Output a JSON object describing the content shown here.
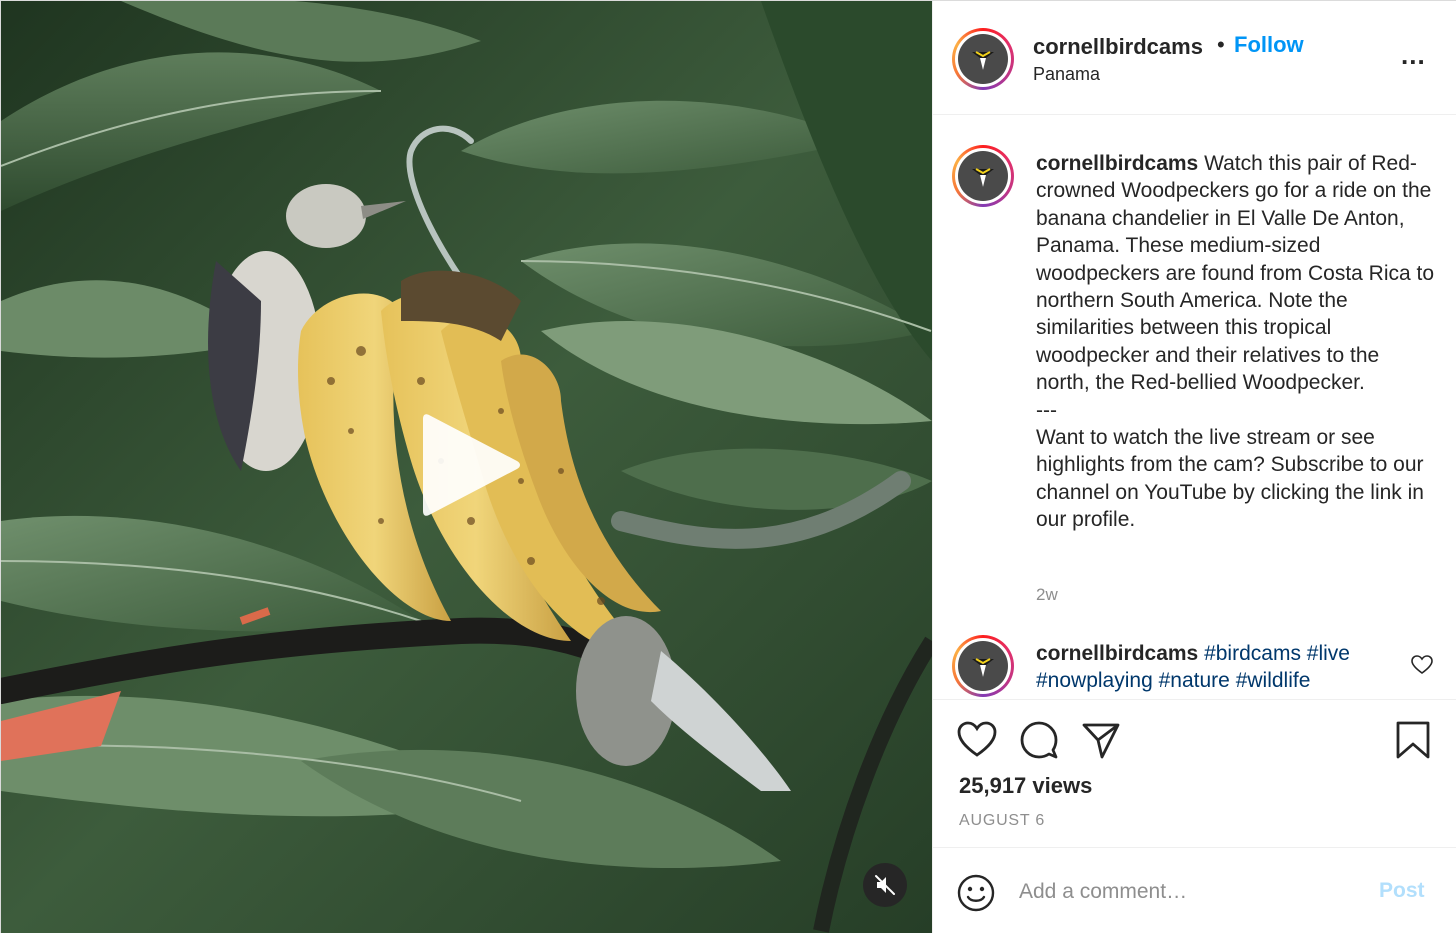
{
  "post": {
    "username": "cornellbirdcams",
    "separator": "•",
    "follow_label": "Follow",
    "location": "Panama",
    "more_label": "..."
  },
  "caption": {
    "username": "cornellbirdcams",
    "text": "Watch this pair of Red-crowned Woodpeckers go for a ride on the banana chandelier in El Valle De Anton, Panama. These medium-sized woodpeckers are found from Costa Rica to northern South America. Note the similarities between this tropical woodpecker and their relatives to the north, the Red-bellied Woodpecker.",
    "divider": "---",
    "text2": "Want to watch the live stream or see highlights from the cam? Subscribe to our channel on YouTube by clicking the link in our profile.",
    "time": "2w"
  },
  "second_comment": {
    "username": "cornellbirdcams",
    "tags": [
      "#birdcams",
      "#live",
      "#nowplaying",
      "#nature",
      "#wildlife"
    ]
  },
  "stats": {
    "views": "25,917 views",
    "date": "AUGUST 6"
  },
  "composer": {
    "placeholder": "Add a comment…",
    "post_label": "Post"
  },
  "icons": {
    "avatar": "cardinal-logo-icon",
    "play": "play-icon",
    "mute": "muted-speaker-icon",
    "like": "heart-icon",
    "comment": "speech-bubble-icon",
    "share": "paper-plane-icon",
    "save": "bookmark-icon",
    "emoji": "smiley-icon"
  },
  "colors": {
    "follow": "#0095f6",
    "post_disabled": "#b2dffc",
    "hashtag": "#00376b",
    "muted_text": "#8e8e8e"
  }
}
